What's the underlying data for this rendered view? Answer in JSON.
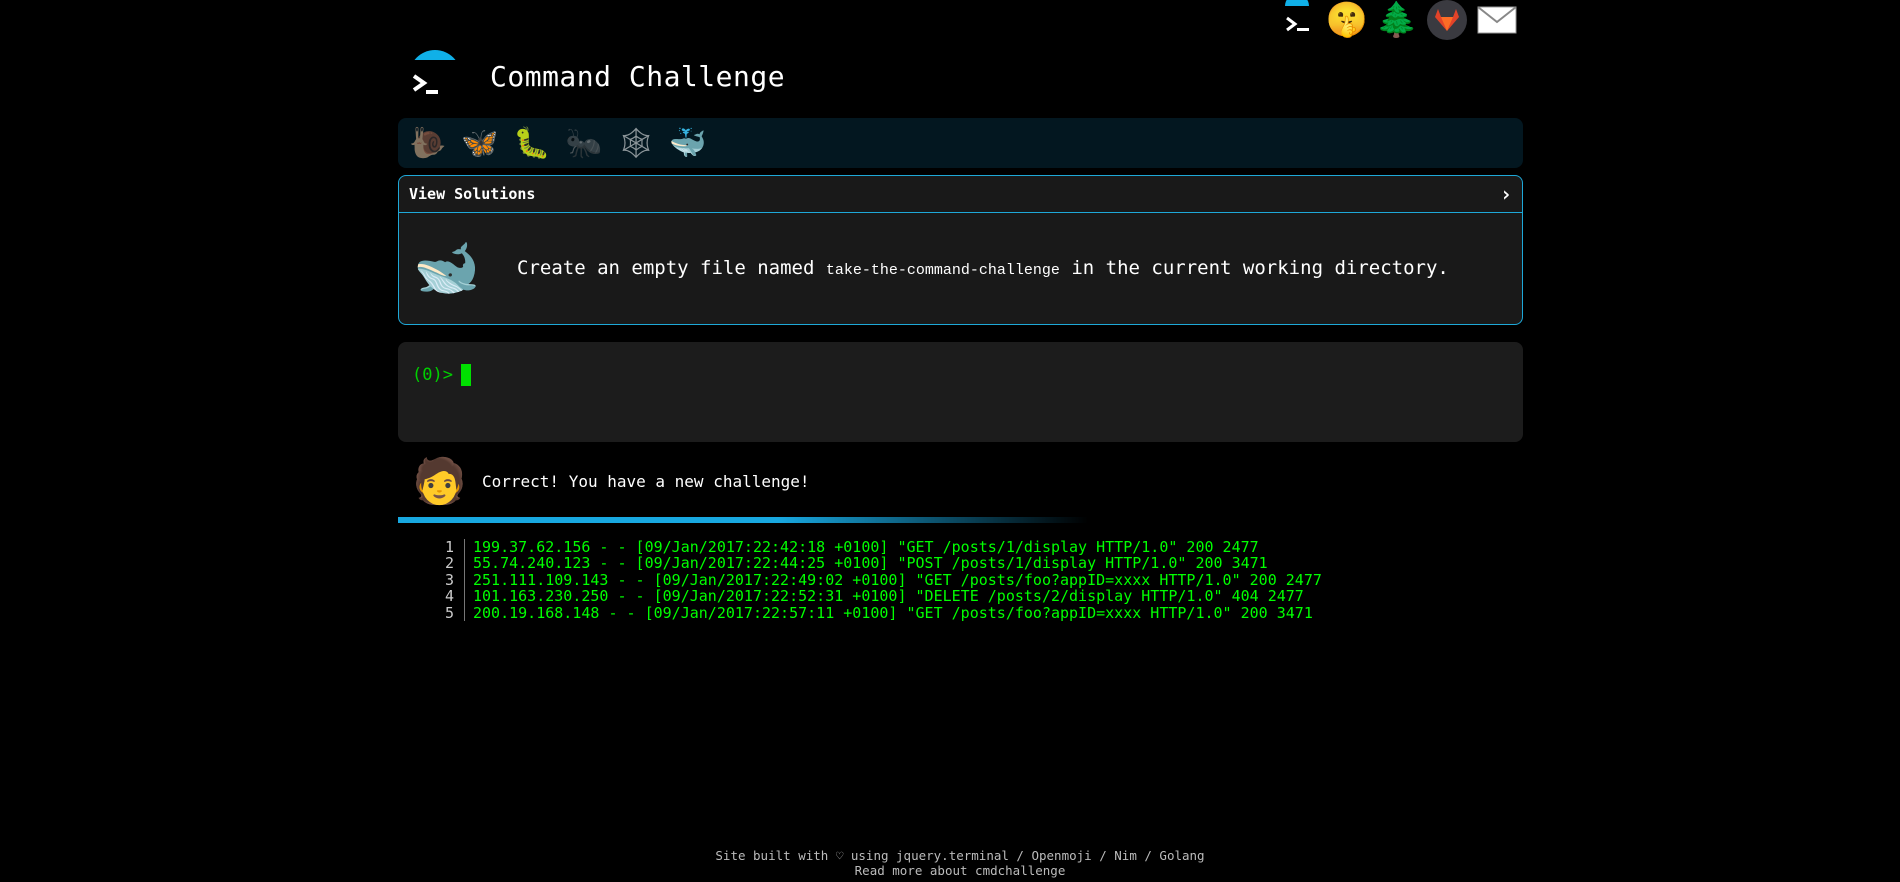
{
  "nav": {
    "items": [
      {
        "icon": "terminal-logo-icon"
      },
      {
        "icon": "shushing-face-icon",
        "glyph": "🤫"
      },
      {
        "icon": "tree-icon",
        "glyph": "🌲"
      },
      {
        "icon": "gitlab-icon"
      },
      {
        "icon": "envelope-icon",
        "glyph": "✉"
      }
    ]
  },
  "header": {
    "title": "Command Challenge"
  },
  "levels": [
    {
      "icon": "snail-icon",
      "glyph": "🐌"
    },
    {
      "icon": "butterfly-icon",
      "glyph": "🦋"
    },
    {
      "icon": "caterpillar-icon",
      "glyph": "🐛"
    },
    {
      "icon": "ant-icon",
      "glyph": "🐜"
    },
    {
      "icon": "spider-web-icon",
      "glyph": "🕸"
    },
    {
      "icon": "whale-icon",
      "glyph": "🐳"
    }
  ],
  "challenge": {
    "solutions_label": "View Solutions",
    "chevron": "›",
    "icon": "whale-icon",
    "glyph": "🐋",
    "text_before": "Create an empty file named ",
    "filename": "take-the-command-challenge",
    "text_after": " in the current working directory."
  },
  "terminal": {
    "prompt": "(0)>"
  },
  "feedback": {
    "avatar_icon": "person-avatar-icon",
    "glyph": "🧑",
    "message": "Correct! You have a new challenge!"
  },
  "log": [
    {
      "n": "1",
      "text": "199.37.62.156 - - [09/Jan/2017:22:42:18 +0100] \"GET /posts/1/display HTTP/1.0\" 200 2477"
    },
    {
      "n": "2",
      "text": "55.74.240.123 - - [09/Jan/2017:22:44:25 +0100] \"POST /posts/1/display HTTP/1.0\" 200 3471"
    },
    {
      "n": "3",
      "text": "251.111.109.143 - - [09/Jan/2017:22:49:02 +0100] \"GET /posts/foo?appID=xxxx HTTP/1.0\" 200 2477"
    },
    {
      "n": "4",
      "text": "101.163.230.250 - - [09/Jan/2017:22:52:31 +0100] \"DELETE /posts/2/display HTTP/1.0\" 404 2477"
    },
    {
      "n": "5",
      "text": "200.19.168.148 - - [09/Jan/2017:22:57:11 +0100] \"GET /posts/foo?appID=xxxx HTTP/1.0\" 200 3471"
    }
  ],
  "footer": {
    "line1": "Site built with ♡ using jquery.terminal / Openmoji / Nim / Golang",
    "line2": "Read more about cmdchallenge"
  },
  "colors": {
    "accent": "#1ea8d8",
    "terminal_green": "#00ff00",
    "panel_bg": "#191919",
    "level_bar_bg": "#031720"
  }
}
